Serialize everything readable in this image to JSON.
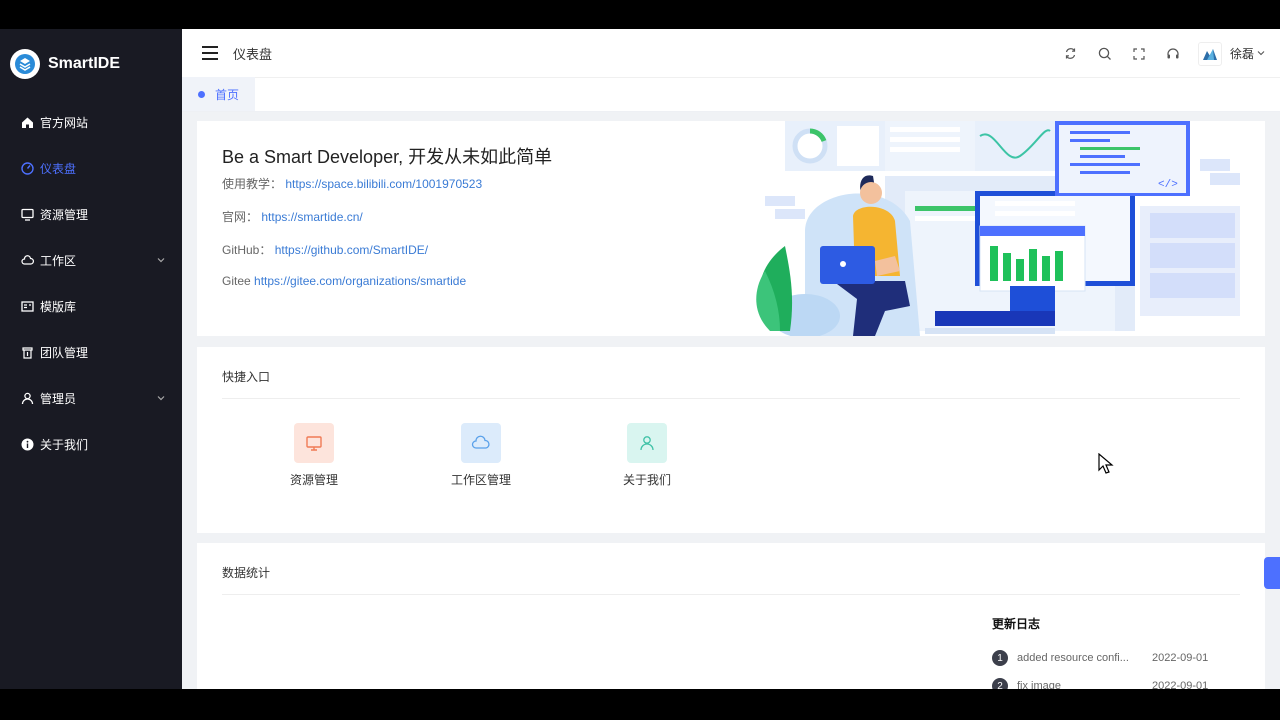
{
  "app": {
    "name": "SmartIDE"
  },
  "sidebar": {
    "items": [
      {
        "label": "官方网站",
        "icon": "home-icon"
      },
      {
        "label": "仪表盘",
        "icon": "dashboard-icon",
        "active": true
      },
      {
        "label": "资源管理",
        "icon": "monitor-icon"
      },
      {
        "label": "工作区",
        "icon": "cloud-icon",
        "expandable": true
      },
      {
        "label": "模版库",
        "icon": "template-icon"
      },
      {
        "label": "团队管理",
        "icon": "team-icon"
      },
      {
        "label": "管理员",
        "icon": "user-icon",
        "expandable": true
      },
      {
        "label": "关于我们",
        "icon": "info-icon"
      }
    ]
  },
  "header": {
    "title": "仪表盘",
    "username": "徐磊"
  },
  "tabs": [
    {
      "label": "首页"
    }
  ],
  "hero": {
    "title": "Be a Smart Developer, 开发从未如此简单",
    "lines": [
      {
        "label": "使用教学：",
        "link": "https://space.bilibili.com/1001970523"
      },
      {
        "label": "官网：",
        "link": "https://smartide.cn/"
      },
      {
        "label": "GitHub：",
        "link": "https://github.com/SmartIDE/"
      },
      {
        "label": "Gitee ",
        "link": "https://gitee.com/organizations/smartide"
      }
    ]
  },
  "quick_entry": {
    "title": "快捷入口",
    "items": [
      {
        "label": "资源管理",
        "icon": "monitor-icon",
        "bg": "#fde4dc",
        "fg": "#f07a55"
      },
      {
        "label": "工作区管理",
        "icon": "cloud-icon",
        "bg": "#dcebfb",
        "fg": "#5aa1ea"
      },
      {
        "label": "关于我们",
        "icon": "user-icon",
        "bg": "#d9f5f0",
        "fg": "#40c2a7"
      }
    ]
  },
  "stats": {
    "title": "数据统计",
    "changelog": {
      "title": "更新日志",
      "entries": [
        {
          "num": "1",
          "text": "added resource confi...",
          "date": "2022-09-01"
        },
        {
          "num": "2",
          "text": "fix image",
          "date": "2022-09-01"
        }
      ]
    }
  },
  "colors": {
    "accent": "#4d70ff",
    "sidebar_bg": "#191a23",
    "link": "#3a7bd5"
  }
}
